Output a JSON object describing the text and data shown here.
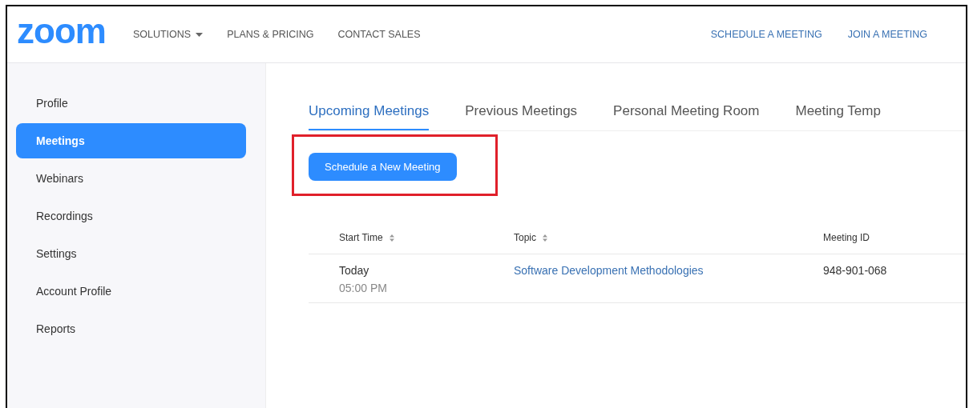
{
  "header": {
    "logo": "zoom",
    "nav": [
      {
        "label": "SOLUTIONS",
        "dropdown": true
      },
      {
        "label": "PLANS & PRICING",
        "dropdown": false
      },
      {
        "label": "CONTACT SALES",
        "dropdown": false
      }
    ],
    "actions": [
      "SCHEDULE A MEETING",
      "JOIN A MEETING"
    ]
  },
  "sidebar": {
    "items": [
      {
        "label": "Profile",
        "selected": false
      },
      {
        "label": "Meetings",
        "selected": true
      },
      {
        "label": "Webinars",
        "selected": false
      },
      {
        "label": "Recordings",
        "selected": false
      },
      {
        "label": "Settings",
        "selected": false
      },
      {
        "label": "Account Profile",
        "selected": false
      },
      {
        "label": "Reports",
        "selected": false
      }
    ]
  },
  "tabs": [
    {
      "label": "Upcoming Meetings",
      "selected": true
    },
    {
      "label": "Previous Meetings",
      "selected": false
    },
    {
      "label": "Personal Meeting Room",
      "selected": false
    },
    {
      "label": "Meeting Temp",
      "selected": false
    }
  ],
  "schedule_button": {
    "label": "Schedule a New Meeting",
    "highlighted": true
  },
  "table": {
    "columns": [
      {
        "label": "Start Time",
        "sortable": true
      },
      {
        "label": "Topic",
        "sortable": true
      },
      {
        "label": "Meeting ID",
        "sortable": false
      }
    ],
    "rows": [
      {
        "day": "Today",
        "time": "05:00 PM",
        "topic": "Software Development Methodologies",
        "meeting_id": "948-901-068"
      }
    ]
  }
}
